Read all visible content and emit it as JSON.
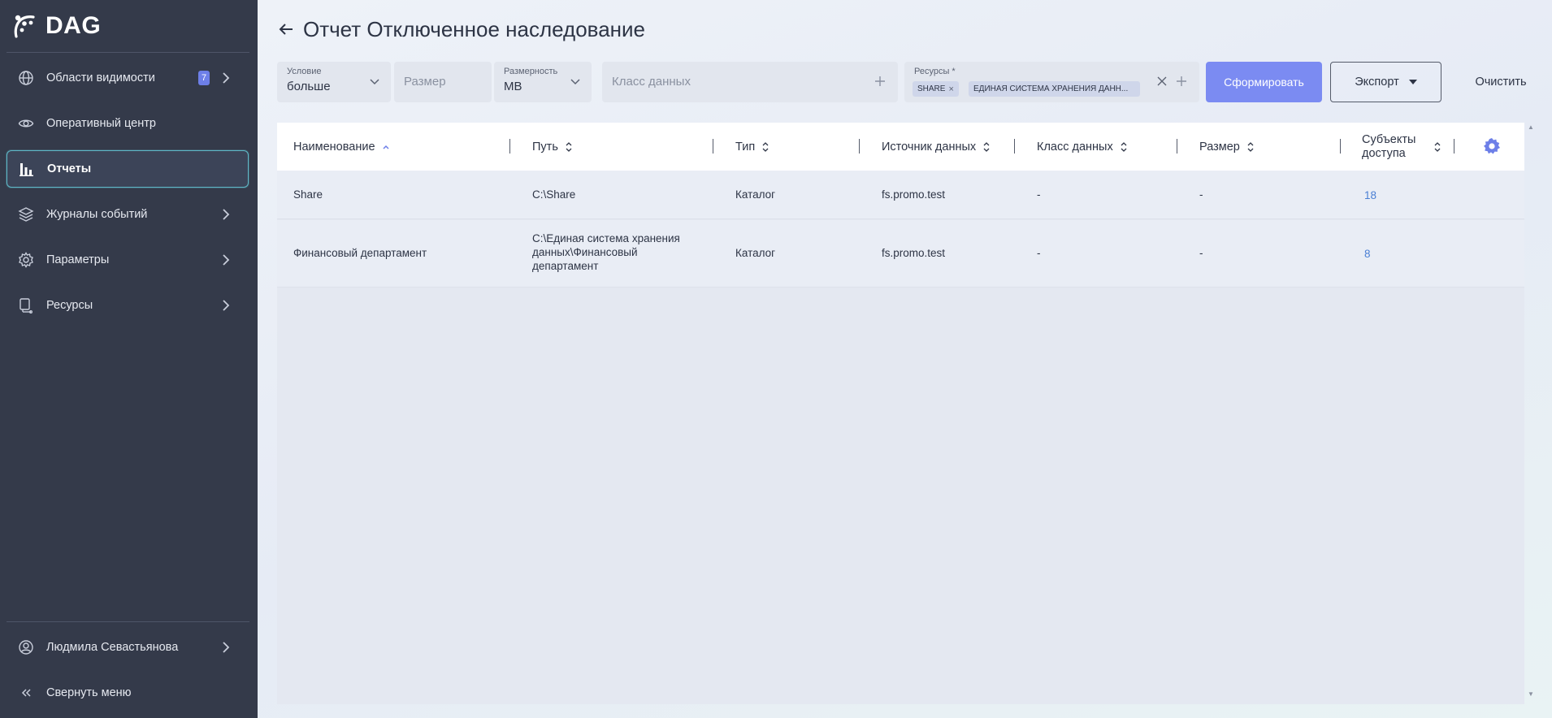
{
  "app": {
    "logo_text": "DAG"
  },
  "sidebar": {
    "items": [
      {
        "label": "Области видимости",
        "icon": "globe-icon",
        "badge": "7",
        "has_chevron": true
      },
      {
        "label": "Оперативный центр",
        "icon": "eye-icon",
        "has_chevron": false
      },
      {
        "label": "Отчеты",
        "icon": "bar-chart-icon",
        "has_chevron": false,
        "active": true
      },
      {
        "label": "Журналы событий",
        "icon": "layers-icon",
        "has_chevron": true
      },
      {
        "label": "Параметры",
        "icon": "gear-icon",
        "has_chevron": true
      },
      {
        "label": "Ресурсы",
        "icon": "server-icon",
        "has_chevron": true
      }
    ],
    "user": {
      "name": "Людмила Севастьянова",
      "icon": "user-circle-icon"
    },
    "collapse_label": "Свернуть меню"
  },
  "header": {
    "title": "Отчет Отключенное наследование"
  },
  "filters": {
    "condition": {
      "label": "Условие",
      "value": "больше"
    },
    "size": {
      "placeholder": "Размер"
    },
    "unit": {
      "label": "Размерность",
      "value": "MB"
    },
    "data_class": {
      "placeholder": "Класс данных"
    },
    "resources": {
      "label": "Ресурсы *",
      "chips": [
        "SHARE",
        "ЕДИНАЯ СИСТЕМА ХРАНЕНИЯ ДАНН..."
      ]
    }
  },
  "buttons": {
    "generate": "Сформировать",
    "export": "Экспорт",
    "clear": "Очистить"
  },
  "table": {
    "columns": [
      "Наименование",
      "Путь",
      "Тип",
      "Источник данных",
      "Класс данных",
      "Размер",
      "Субъекты доступа"
    ],
    "rows": [
      {
        "name": "Share",
        "path": "C:\\Share",
        "type": "Каталог",
        "source": "fs.promo.test",
        "data_class": "-",
        "size": "-",
        "subjects": "18"
      },
      {
        "name": "Финансовый департамент",
        "path_lines": [
          "C:\\Единая система хранения",
          "данных\\Финансовый",
          "департамент"
        ],
        "type": "Каталог",
        "source": "fs.promo.test",
        "data_class": "-",
        "size": "-",
        "subjects": "8"
      }
    ]
  },
  "colors": {
    "sidebar_bg": "#343a4a",
    "accent": "#7b8bf2",
    "active_border": "#5fb8c7",
    "link": "#4a7fd4",
    "badge": "#6d7fe8"
  }
}
